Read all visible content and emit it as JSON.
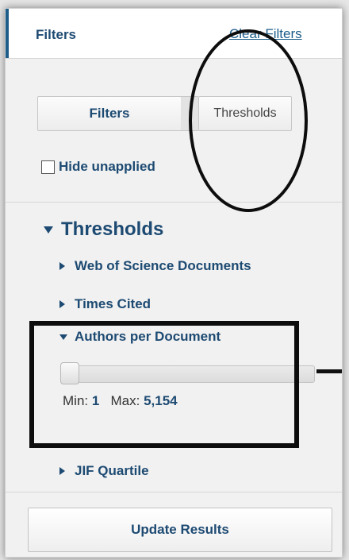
{
  "header": {
    "title": "Filters",
    "clear_link": "Clear Filters"
  },
  "tabs": {
    "filters": "Filters",
    "thresholds": "Thresholds"
  },
  "hide_unapplied": {
    "label": "Hide unapplied",
    "checked": false
  },
  "thresholds_section": {
    "title": "Thresholds",
    "items": [
      {
        "label": "Web of Science Documents",
        "expanded": false
      },
      {
        "label": "Times Cited",
        "expanded": false
      },
      {
        "label": "Authors per Document",
        "expanded": true
      },
      {
        "label": "JIF Quartile",
        "expanded": false
      }
    ],
    "authors_range": {
      "min_label": "Min:",
      "min": "1",
      "max_label": "Max:",
      "max": "5,154"
    }
  },
  "update_button": "Update Results",
  "colors": {
    "accent": "#1d4a72",
    "link": "#1d5d8a",
    "annotation": "#0d0d0d"
  }
}
